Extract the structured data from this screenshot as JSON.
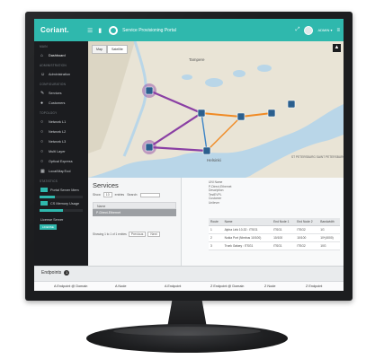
{
  "app": {
    "logo": "Coriant.",
    "portal_title": "Service Provisioning Portal",
    "user": "ADMIN ▾"
  },
  "colors": {
    "accent": "#2fb8ad",
    "sidebar": "#1b1c1f",
    "route_purple": "#8a3fa4",
    "route_orange": "#f08a24"
  },
  "sidebar": {
    "sections": {
      "main": "MAIN",
      "admin": "ADMINISTRATION",
      "config": "CONFIGURATION",
      "topology": "TOPOLOGY",
      "statistics": "STATISTICS"
    },
    "items": [
      {
        "label": "Dashboard",
        "icon": "home-icon"
      },
      {
        "label": "Administration",
        "icon": "users-icon"
      },
      {
        "label": "Services",
        "icon": "pencil-icon"
      },
      {
        "label": "Customers",
        "icon": "person-icon"
      },
      {
        "label": "Network L1",
        "icon": "circle-icon"
      },
      {
        "label": "Network L2",
        "icon": "circle-icon"
      },
      {
        "label": "Network L3",
        "icon": "circle-icon"
      },
      {
        "label": "Multi Layer",
        "icon": "circle-icon"
      },
      {
        "label": "Optical Express",
        "icon": "circle-icon"
      },
      {
        "label": "Local/MapTool",
        "icon": "map-icon"
      }
    ],
    "stats": [
      {
        "label": "Portal Server Mem",
        "value": 0.35
      },
      {
        "label": "CS Memory Usage",
        "value": 0.55
      }
    ],
    "license_label": "License Server",
    "license_toggle": "LICENSE"
  },
  "map": {
    "tabs": [
      "Map",
      "Satellite"
    ],
    "labels": [
      "Tampere",
      "Helsinki",
      "ST PETERSBURG SAINT PETERSBURG"
    ]
  },
  "services": {
    "title": "Services",
    "show_label": "Show",
    "show_value": "10",
    "entries_label": "entries",
    "search_label": "Search:",
    "column": "Name",
    "selected_row": "P-Direct-Ethernet",
    "pager_text": "Showing 1 to 1 of 1 entries",
    "prev": "Previous",
    "next": "Next"
  },
  "details": {
    "lines": [
      "UNI Name",
      "P-Direct-Ethernet",
      "Description",
      "TestEVPL",
      "Customer",
      "Unilever"
    ],
    "columns": [
      "Route",
      "Name",
      "End Node 1",
      "End Node 2",
      "Bandwidth"
    ],
    "rows": [
      [
        "1",
        "Alpha Link 10-32 : ITSG1",
        "ITSG1",
        "ITSG2",
        "1G"
      ],
      [
        "2",
        "Nokia Port (Nimbus 10/100)",
        "10/100",
        "10/100",
        "10*(4000)"
      ],
      [
        "3",
        "Trunk Galaxy : ITSG1",
        "ITSG1",
        "ITSG2",
        "10G"
      ]
    ]
  },
  "endpoints": {
    "title": "Endpoints",
    "count": "1",
    "columns": [
      "A Endpoint @ Domain",
      "A Node",
      "A Endpoint",
      "Z Endpoint @ Domain",
      "Z Node",
      "Z Endpoint"
    ]
  }
}
